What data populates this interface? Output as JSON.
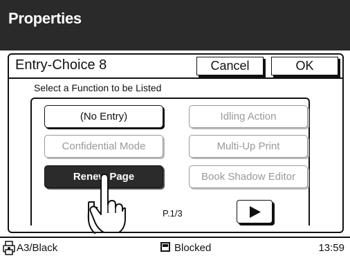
{
  "header": {
    "title": "Properties"
  },
  "dialog": {
    "title": "Entry-Choice 8",
    "cancel_label": "Cancel",
    "ok_label": "OK",
    "subtitle": "Select a Function to be Listed"
  },
  "functions": [
    {
      "label": "(No Entry)",
      "state": "enabled"
    },
    {
      "label": "Idling Action",
      "state": "disabled"
    },
    {
      "label": "Confidential Mode",
      "state": "disabled"
    },
    {
      "label": "Multi-Up Print",
      "state": "disabled"
    },
    {
      "label": "Renew Page",
      "state": "selected"
    },
    {
      "label": "Book Shadow Editor",
      "state": "disabled"
    }
  ],
  "pagination": {
    "page_label": "P.1/3",
    "next_icon": "play-triangle-icon"
  },
  "status_bar": {
    "paper": "A3/Black",
    "paper_icon": "printer-paper-icon",
    "state_icon": "blocked-square-icon",
    "state": "Blocked",
    "time": "13:59"
  },
  "colors": {
    "header_bg": "#2a2a2a",
    "selected_bg": "#2b2b2b",
    "disabled_text": "#999999",
    "border": "#111111"
  }
}
